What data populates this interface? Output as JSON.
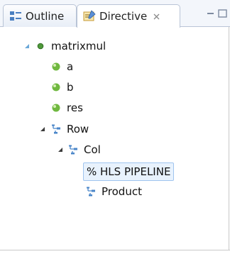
{
  "tabs": {
    "outline": {
      "label": "Outline",
      "icon": "outline-icon"
    },
    "directive": {
      "label": "Directive",
      "icon": "directive-icon",
      "active": true
    }
  },
  "tree": {
    "root": {
      "label": "matrixmul",
      "icon": "function-dot-icon"
    },
    "a": {
      "label": "a",
      "icon": "variable-ball-icon"
    },
    "b": {
      "label": "b",
      "icon": "variable-ball-icon"
    },
    "res": {
      "label": "res",
      "icon": "variable-ball-icon"
    },
    "row": {
      "label": "Row",
      "icon": "loop-icon"
    },
    "col": {
      "label": "Col",
      "icon": "loop-icon"
    },
    "directive": {
      "label": "% HLS PIPELINE",
      "selected": true
    },
    "product": {
      "label": "Product",
      "icon": "loop-icon"
    }
  },
  "colors": {
    "selection_bg": "#e8f2fd",
    "selection_border": "#9fc4ef",
    "tab_border": "#b9c4d6",
    "variable_green": "#5a9e2f"
  }
}
